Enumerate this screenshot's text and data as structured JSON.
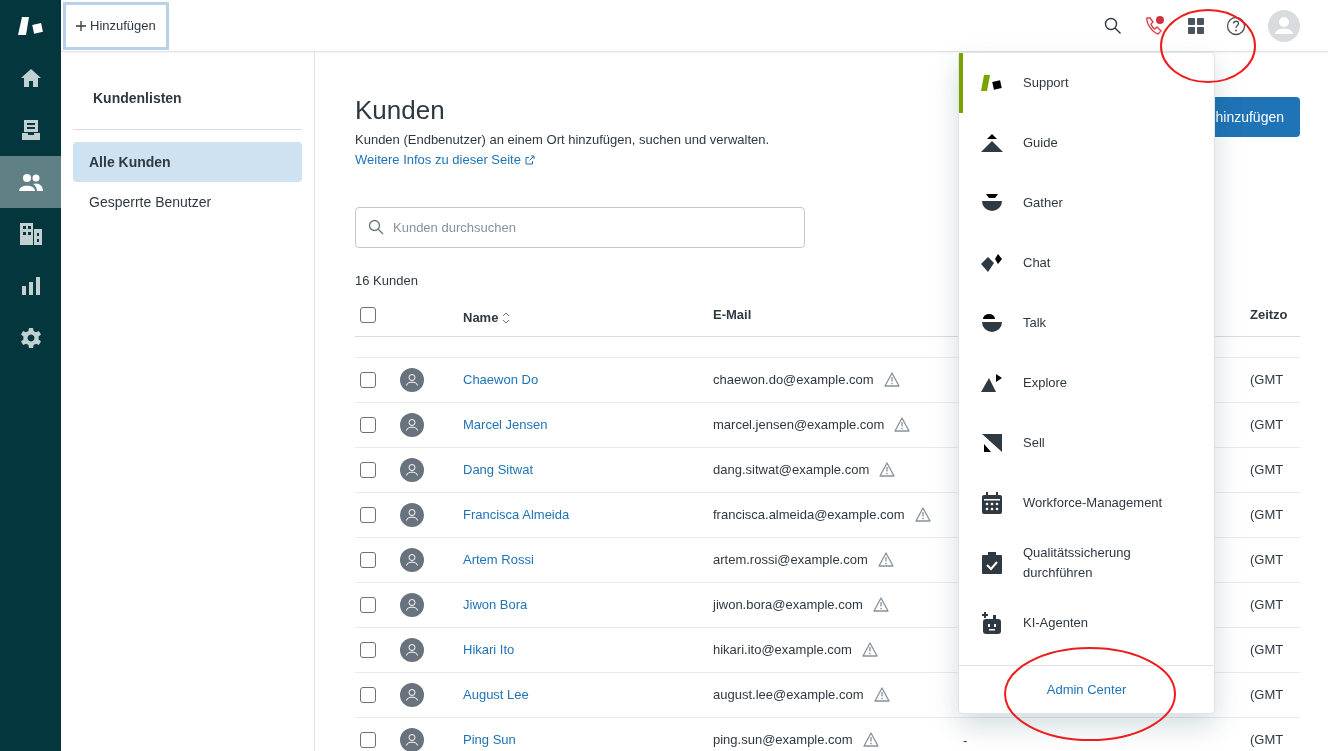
{
  "top_bar": {
    "add_button": "Hinzufügen"
  },
  "nav": [
    {
      "kind": "home",
      "selected": false
    },
    {
      "kind": "tickets",
      "selected": false
    },
    {
      "kind": "customers",
      "selected": true
    },
    {
      "kind": "organizations",
      "selected": false
    },
    {
      "kind": "reports",
      "selected": false
    },
    {
      "kind": "settings",
      "selected": false
    }
  ],
  "lists": {
    "title": "Kundenlisten",
    "items": [
      {
        "label": "Alle Kunden",
        "selected": true
      },
      {
        "label": "Gesperrte Benutzer",
        "selected": false
      }
    ]
  },
  "page": {
    "title": "Kunden",
    "subtitle": "Kunden (Endbenutzer) an einem Ort hinzufügen, suchen und verwalten.",
    "link": "Weitere Infos zu dieser Seite",
    "add_button": "hinzufügen",
    "search": {
      "placeholder": "Kunden durchsuchen"
    },
    "count": "16 Kunden"
  },
  "table": {
    "header_checked": false,
    "columns": [
      "Name",
      "E-Mail",
      "Zeitzo"
    ],
    "rows": [
      {
        "name": "Chaewon Do",
        "email": "chaewon.do@example.com",
        "timezone": "(GMT",
        "checked": false
      },
      {
        "name": "Marcel Jensen",
        "email": "marcel.jensen@example.com",
        "timezone": "(GMT",
        "checked": false
      },
      {
        "name": "Dang Sitwat",
        "email": "dang.sitwat@example.com",
        "timezone": "(GMT",
        "checked": false
      },
      {
        "name": "Francisca Almeida",
        "email": "francisca.almeida@example.com",
        "timezone": "(GMT",
        "checked": false
      },
      {
        "name": "Artem Rossi",
        "email": "artem.rossi@example.com",
        "timezone": "(GMT",
        "checked": false
      },
      {
        "name": "Jiwon Bora",
        "email": "jiwon.bora@example.com",
        "timezone": "(GMT",
        "checked": false
      },
      {
        "name": "Hikari Ito",
        "email": "hikari.ito@example.com",
        "timezone": "(GMT",
        "checked": false
      },
      {
        "name": "August Lee",
        "email": "august.lee@example.com",
        "timezone": "(GMT",
        "checked": false
      },
      {
        "name": "Ping Sun",
        "email": "ping.sun@example.com",
        "column_4": "-",
        "timezone": "(GMT",
        "checked": false
      }
    ]
  },
  "app_menu": {
    "items": [
      {
        "label": "Support",
        "kind": "support",
        "selected": true
      },
      {
        "label": "Guide",
        "kind": "guide",
        "selected": false
      },
      {
        "label": "Gather",
        "kind": "gather",
        "selected": false
      },
      {
        "label": "Chat",
        "kind": "chat",
        "selected": false
      },
      {
        "label": "Talk",
        "kind": "talk",
        "selected": false
      },
      {
        "label": "Explore",
        "kind": "explore",
        "selected": false
      },
      {
        "label": "Sell",
        "kind": "sell",
        "selected": false
      },
      {
        "label": "Workforce-Management",
        "kind": "calendar",
        "selected": false
      },
      {
        "label": "Qualitätssicherung durchführen",
        "kind": "clipboard",
        "selected": false
      },
      {
        "label": "KI-Agenten",
        "kind": "robot",
        "selected": false
      }
    ],
    "footer": "Admin Center"
  }
}
